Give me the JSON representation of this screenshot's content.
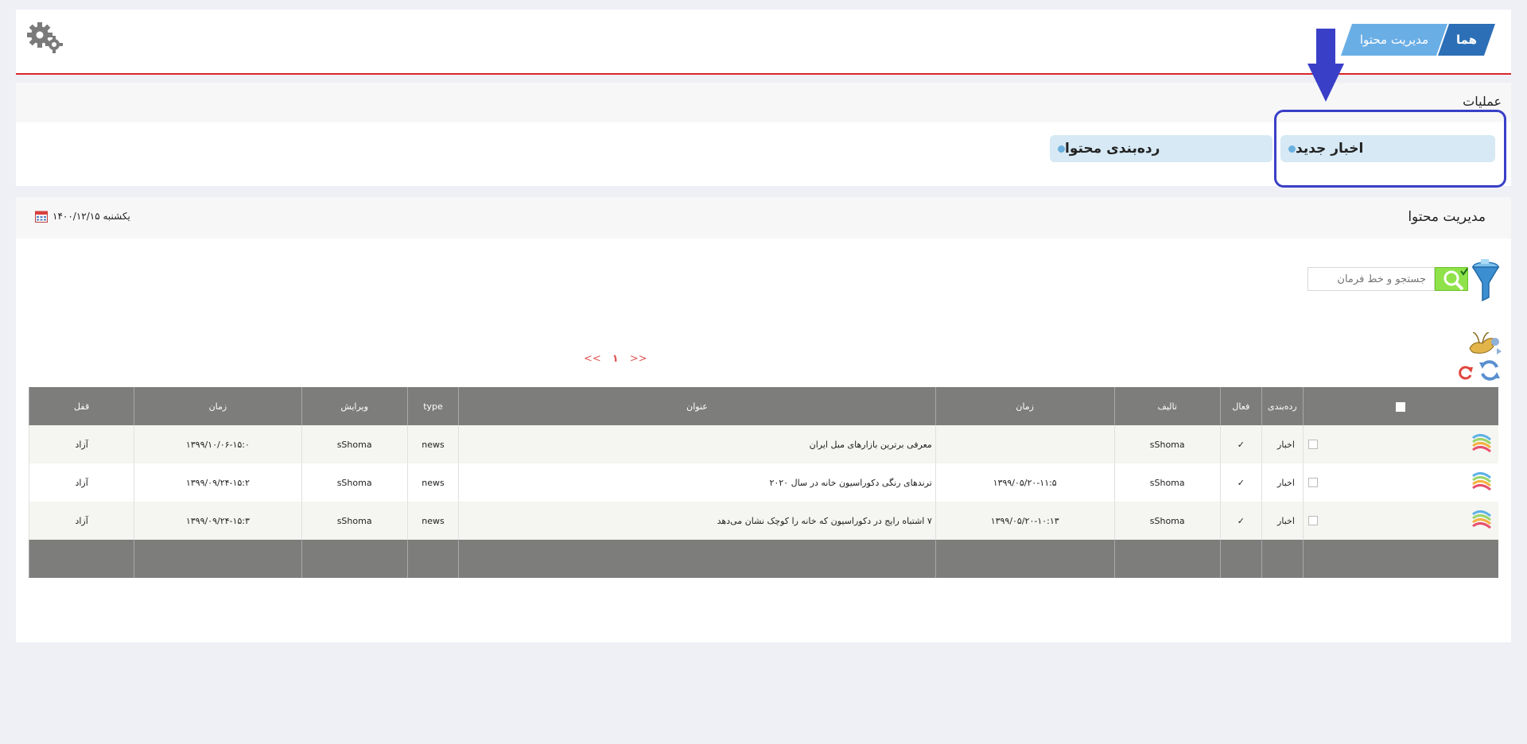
{
  "breadcrumb": {
    "home": "هما",
    "current": "مدیریت محتوا"
  },
  "operations": {
    "title": "عملیات",
    "buttons": [
      {
        "label": "اخبار جدید"
      },
      {
        "label": "رده‌بندی محتوا"
      }
    ]
  },
  "content": {
    "title": "مدیریت محتوا",
    "date": "یکشنبه ۱۴۰۰/۱۲/۱۵",
    "search": {
      "placeholder": "جستجو و خط فرمان"
    },
    "pager": {
      "prev": "<<",
      "current": "۱",
      "next": ">>"
    },
    "table": {
      "headers": [
        "رده‌بندی",
        "فعال",
        "تالیف",
        "زمان",
        "عنوان",
        "type",
        "ویرایش",
        "زمان",
        "قفل"
      ],
      "rows": [
        {
          "category": "اخبار",
          "active": "✓",
          "author": "sShoma",
          "time": "",
          "title": "معرفی برترین بازارهای مبل ایران",
          "type": "news",
          "editor": "sShoma",
          "edit_time": "۱۳۹۹/۱۰/۰۶-۱۵:۰",
          "lock": "آزاد"
        },
        {
          "category": "اخبار",
          "active": "✓",
          "author": "sShoma",
          "time": "۱۳۹۹/۰۵/۲۰-۱۱:۵",
          "title": "ترندهای رنگی دکوراسیون خانه در سال ۲۰۲۰",
          "type": "news",
          "editor": "sShoma",
          "edit_time": "۱۳۹۹/۰۹/۲۴-۱۵:۲",
          "lock": "آزاد"
        },
        {
          "category": "اخبار",
          "active": "✓",
          "author": "sShoma",
          "time": "۱۳۹۹/۰۵/۲۰-۱۰:۱۳",
          "title": "۷ اشتباه رایج در دکوراسیون که خانه را کوچک نشان می‌دهد",
          "type": "news",
          "editor": "sShoma",
          "edit_time": "۱۳۹۹/۰۹/۲۴-۱۵:۳",
          "lock": "آزاد"
        }
      ]
    }
  },
  "colors": {
    "accent_red": "#d9262c",
    "crumb_home": "#2d6fb7",
    "crumb_current": "#6aaee6",
    "button_bg": "#d6e9f4",
    "table_header": "#7d7e7c",
    "annotation": "#3a3fc8"
  },
  "icons": [
    "gear-icon",
    "arrow-down-icon",
    "calendar-icon",
    "funnel-icon",
    "search-icon",
    "bird-icon",
    "refresh-icon",
    "stack-icon",
    "check-icon"
  ]
}
